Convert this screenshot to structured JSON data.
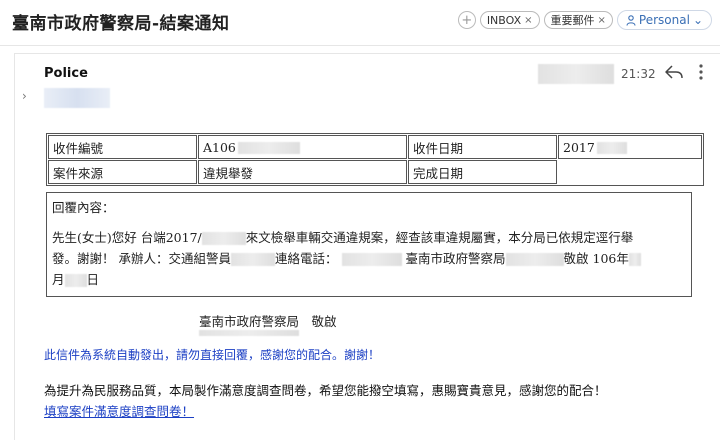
{
  "email": {
    "subject": "臺南市政府警察局-結案通知",
    "sender": "Police",
    "time": "21:32"
  },
  "labels": [
    {
      "name": "INBOX",
      "remove": "×"
    },
    {
      "name": "重要郵件",
      "remove": "×"
    }
  ],
  "account": {
    "label": "Personal",
    "chevron": "⌄"
  },
  "toolbar": {
    "add": "+"
  },
  "info_table": {
    "case_no_label": "收件編號",
    "case_no_value": "A106",
    "received_label": "收件日期",
    "received_value": "2017",
    "source_label": "案件來源",
    "source_value": "違規舉發",
    "completed_label": "完成日期",
    "completed_value": ""
  },
  "reply": {
    "heading": "回覆內容：",
    "line1_a": "先生(女士)您好 台端2017/",
    "line1_b": "來文檢舉車輛交通違規案，經查該車違規屬實，本分局已依規定逕行舉",
    "line2_a": "發。謝謝！ 承辦人：交通組警員",
    "line2_b": "連絡電話：",
    "line2_c": "臺南市政府警察局",
    "line2_d": "敬啟 106年",
    "line3_a": "月",
    "line3_b": "日"
  },
  "signoff": "臺南市政府警察局　敬啟",
  "auto_note": "此信件為系統自動發出，請勿直接回覆，感謝您的配合。謝謝！",
  "survey_text": "為提升為民服務品質，本局製作滿意度調查問卷，希望您能撥空填寫，惠賜寶貴意見，感謝您的配合！",
  "survey_link": "填寫案件滿意度調查問卷！",
  "colors": {
    "link": "#1b3fc4",
    "account": "#3a6fb5"
  }
}
